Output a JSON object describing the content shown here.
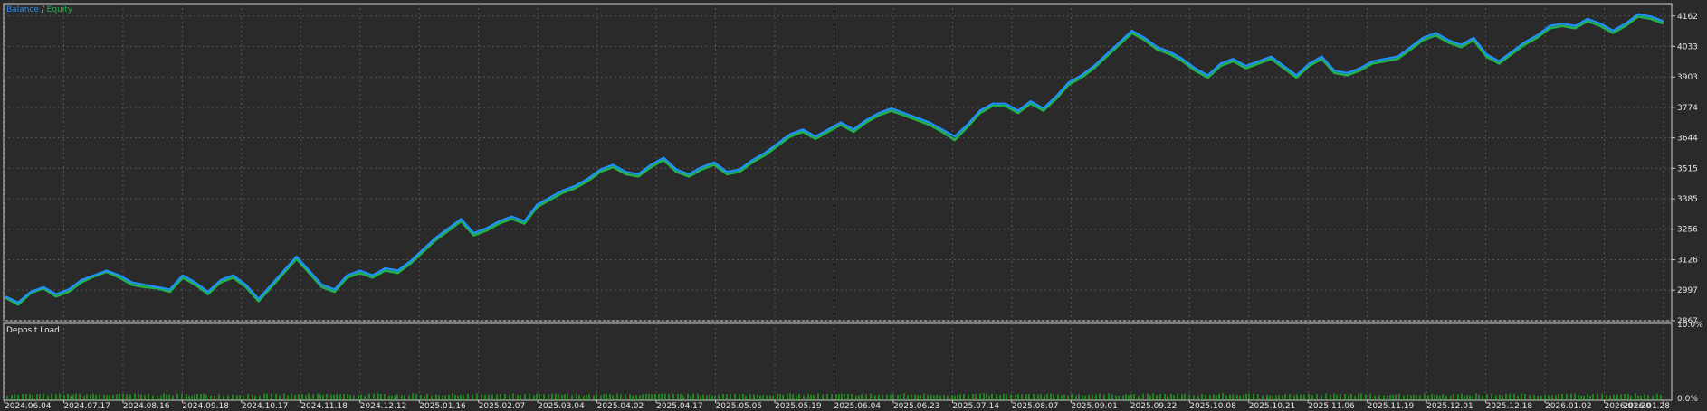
{
  "window": {
    "legend": {
      "balance": "Balance",
      "separator": " / ",
      "equity": "Equity"
    },
    "deposit_title": "Deposit Load"
  },
  "colors": {
    "background": "#2a2a2a",
    "grid": "#555555",
    "balance": "#1e90ff",
    "equity": "#22b14c",
    "deposit": "#19d419",
    "axis_text": "#e6e6e6"
  },
  "chart_data": [
    {
      "type": "line",
      "title": "",
      "series": [
        {
          "name": "Balance",
          "values": [
            2970,
            2945,
            2990,
            3010,
            2980,
            3000,
            3040,
            3060,
            3080,
            3060,
            3030,
            3020,
            3010,
            3000,
            3060,
            3030,
            2990,
            3040,
            3060,
            3020,
            2960,
            3020,
            3080,
            3140,
            3080,
            3020,
            3000,
            3060,
            3080,
            3060,
            3090,
            3080,
            3120,
            3170,
            3220,
            3260,
            3300,
            3240,
            3260,
            3290,
            3310,
            3290,
            3360,
            3390,
            3420,
            3440,
            3470,
            3510,
            3530,
            3500,
            3490,
            3530,
            3560,
            3510,
            3490,
            3520,
            3540,
            3500,
            3510,
            3550,
            3580,
            3620,
            3660,
            3680,
            3650,
            3680,
            3710,
            3680,
            3720,
            3750,
            3770,
            3750,
            3730,
            3710,
            3680,
            3650,
            3700,
            3760,
            3790,
            3790,
            3760,
            3800,
            3770,
            3820,
            3880,
            3910,
            3950,
            4000,
            4050,
            4100,
            4070,
            4030,
            4010,
            3980,
            3940,
            3910,
            3960,
            3980,
            3950,
            3970,
            3990,
            3950,
            3910,
            3960,
            3990,
            3930,
            3920,
            3940,
            3970,
            3980,
            3990,
            4030,
            4070,
            4090,
            4060,
            4040,
            4070,
            4000,
            3970,
            4010,
            4050,
            4080,
            4120,
            4130,
            4120,
            4150,
            4130,
            4100,
            4130,
            4170,
            4160,
            4140
          ],
          "color": "#1e90ff"
        },
        {
          "name": "Equity",
          "values": [
            2965,
            2935,
            2985,
            3005,
            2970,
            2990,
            3030,
            3055,
            3075,
            3050,
            3020,
            3010,
            3005,
            2990,
            3050,
            3020,
            2980,
            3030,
            3050,
            3010,
            2950,
            3010,
            3070,
            3130,
            3070,
            3010,
            2990,
            3050,
            3070,
            3050,
            3080,
            3070,
            3110,
            3160,
            3210,
            3250,
            3290,
            3230,
            3250,
            3280,
            3300,
            3280,
            3350,
            3380,
            3410,
            3430,
            3460,
            3500,
            3520,
            3490,
            3480,
            3520,
            3550,
            3500,
            3480,
            3510,
            3530,
            3490,
            3500,
            3540,
            3570,
            3610,
            3650,
            3670,
            3640,
            3670,
            3700,
            3670,
            3710,
            3740,
            3760,
            3740,
            3720,
            3700,
            3670,
            3635,
            3690,
            3750,
            3780,
            3780,
            3750,
            3790,
            3760,
            3810,
            3870,
            3900,
            3940,
            3990,
            4040,
            4090,
            4060,
            4020,
            4000,
            3970,
            3930,
            3900,
            3950,
            3970,
            3940,
            3960,
            3980,
            3940,
            3900,
            3950,
            3980,
            3920,
            3910,
            3930,
            3960,
            3970,
            3980,
            4020,
            4060,
            4080,
            4050,
            4030,
            4060,
            3990,
            3960,
            4000,
            4040,
            4070,
            4110,
            4120,
            4110,
            4140,
            4120,
            4090,
            4120,
            4160,
            4150,
            4130
          ],
          "color": "#22b14c"
        }
      ],
      "xlabel": "",
      "ylabel": "",
      "ylim": [
        2867,
        4215
      ],
      "y_ticks": [
        "4162",
        "4033",
        "3903",
        "3774",
        "3644",
        "3515",
        "3385",
        "3256",
        "3126",
        "2997",
        "2867"
      ],
      "y_tick_values": [
        4162,
        4033,
        3903,
        3774,
        3644,
        3515,
        3385,
        3256,
        3126,
        2997,
        2867
      ],
      "grid": true,
      "legend": "top-left"
    },
    {
      "type": "bar",
      "title": "Deposit Load",
      "ylim": [
        0,
        10
      ],
      "y_ticks": [
        "10.0%",
        "0.0%"
      ],
      "y_tick_values": [
        10,
        0
      ],
      "typical_load_percent": [
        0.6,
        0.9
      ],
      "grid": true
    }
  ],
  "x_axis": {
    "labels": [
      "2024.06.04",
      "2024.07.17",
      "2024.08.16",
      "2024.09.18",
      "2024.10.17",
      "2024.11.18",
      "2024.12.12",
      "2025.01.16",
      "2025.02.07",
      "2025.03.04",
      "2025.04.02",
      "2025.04.17",
      "2025.05.05",
      "2025.05.19",
      "2025.06.04",
      "2025.06.23",
      "2025.07.14",
      "2025.08.07",
      "2025.09.01",
      "2025.09.22",
      "2025.10.08",
      "2025.10.21",
      "2025.11.06",
      "2025.11.19",
      "2025.12.01",
      "2025.12.18",
      "2026.01.02",
      "2026.01.20",
      "2026.01.28"
    ]
  }
}
